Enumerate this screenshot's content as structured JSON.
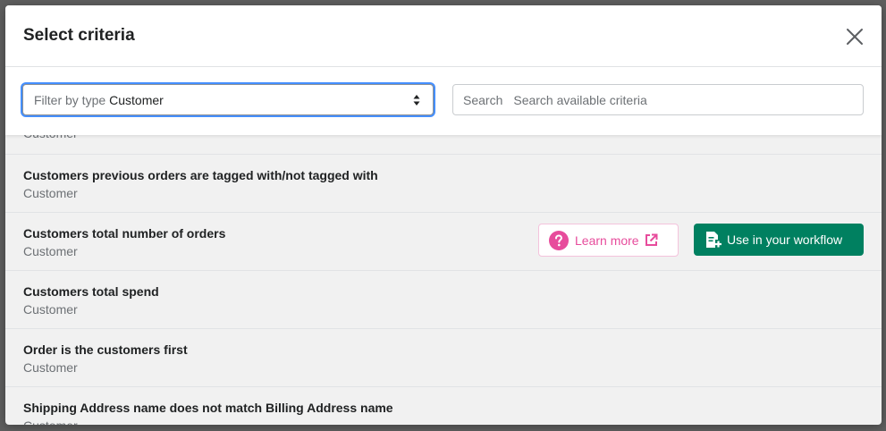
{
  "modal": {
    "title": "Select criteria"
  },
  "filter": {
    "prefix": "Filter by type",
    "selected": "Customer"
  },
  "search": {
    "label": "Search",
    "placeholder": "Search available criteria"
  },
  "list": {
    "partial_top_sub": "Customer",
    "items": [
      {
        "title": "Customers previous orders are tagged with/not tagged with",
        "type": "Customer"
      },
      {
        "title": "Customers total number of orders",
        "type": "Customer"
      },
      {
        "title": "Customers total spend",
        "type": "Customer"
      },
      {
        "title": "Order is the customers first",
        "type": "Customer"
      },
      {
        "title": "Shipping Address name does not match Billing Address name",
        "type": "Customer"
      }
    ]
  },
  "actions": {
    "learn_more": "Learn more",
    "use_workflow": "Use in your workflow"
  },
  "colors": {
    "primary_green": "#008060",
    "learn_pink": "#e74c9c",
    "focus_blue": "#458fff"
  },
  "icons": {
    "close": "close-icon",
    "select_arrows": "select-arrows-icon",
    "help": "help-circle-icon",
    "external": "external-link-icon",
    "doc_add": "document-add-icon"
  }
}
